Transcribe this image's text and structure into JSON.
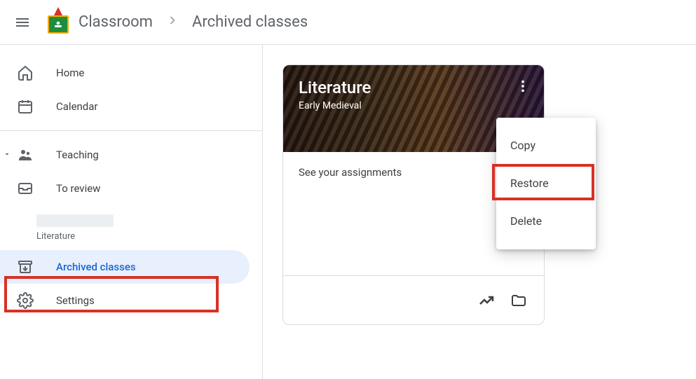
{
  "header": {
    "app_name": "Classroom",
    "page_title": "Archived classes"
  },
  "sidebar": {
    "items": [
      {
        "label": "Home"
      },
      {
        "label": "Calendar"
      },
      {
        "label": "Teaching"
      },
      {
        "label": "To review"
      },
      {
        "label": "Literature"
      },
      {
        "label": "Archived classes"
      },
      {
        "label": "Settings"
      }
    ]
  },
  "card": {
    "title": "Literature",
    "subtitle": "Early Medieval",
    "body_text": "See your assignments"
  },
  "menu": {
    "items": [
      {
        "label": "Copy"
      },
      {
        "label": "Restore"
      },
      {
        "label": "Delete"
      }
    ]
  }
}
